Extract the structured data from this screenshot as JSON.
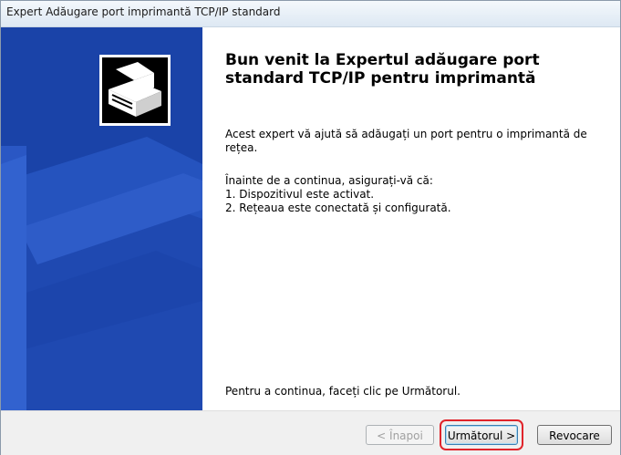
{
  "window": {
    "title": "Expert Adăugare port imprimantă TCP/IP standard"
  },
  "main": {
    "heading": "Bun venit la Expertul adăugare port standard TCP/IP pentru imprimantă",
    "intro": "Acest expert vă ajută să adăugați un port pentru o imprimantă de rețea.",
    "before_text": "Înainte de a continua, asigurați-vă că:",
    "step1": "1.  Dispozitivul este activat.",
    "step2": "2.  Rețeaua este conectată și configurată.",
    "continue_text": "Pentru a continua, faceți clic pe Următorul."
  },
  "buttons": {
    "back": "< Înapoi",
    "next": "Următorul >",
    "cancel": "Revocare"
  },
  "colors": {
    "sidebar": "#1a43a8",
    "highlight": "#e0242b"
  }
}
